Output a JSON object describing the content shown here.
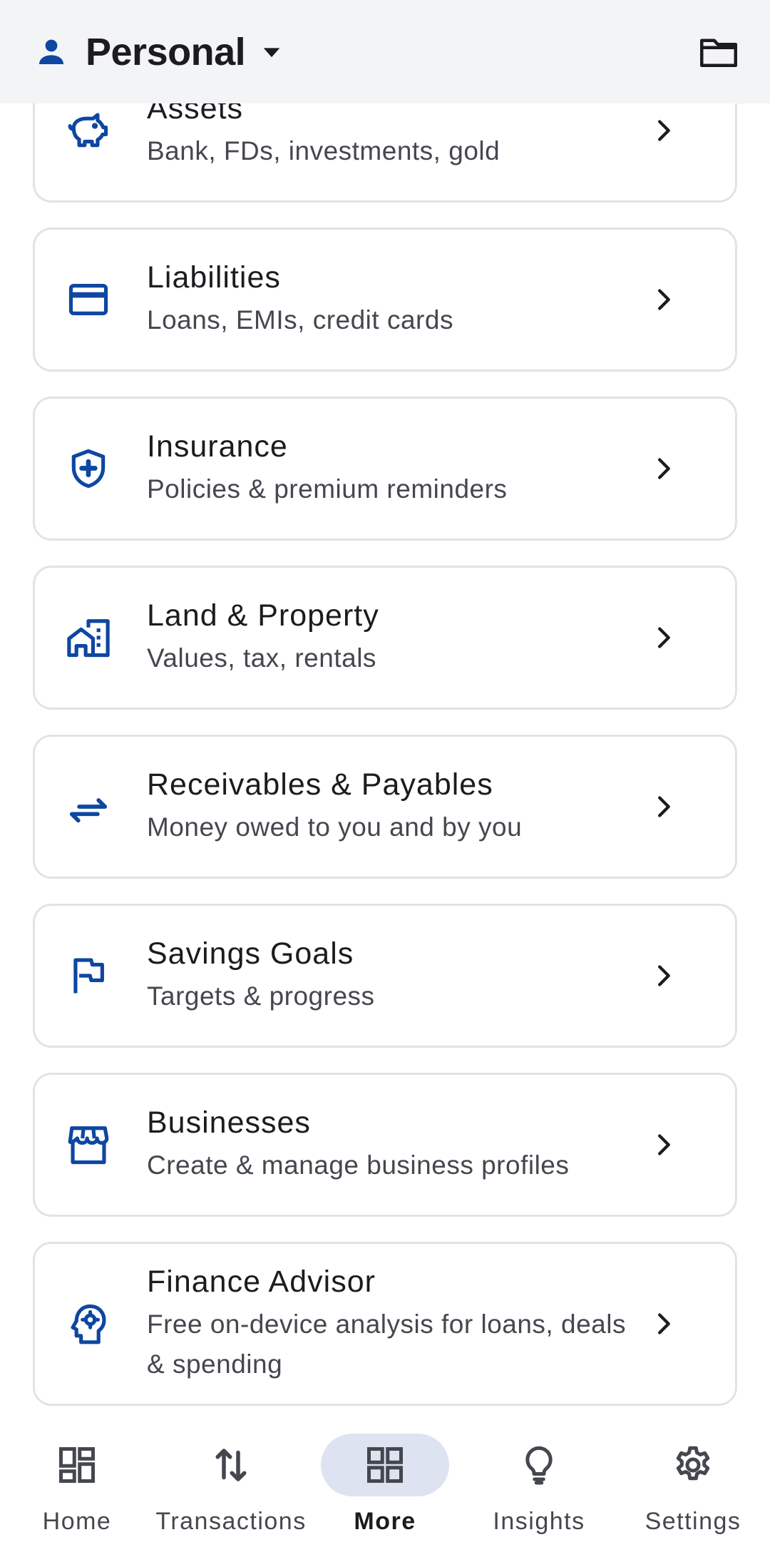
{
  "app_bar": {
    "title": "Personal",
    "icons": {
      "profile": "person-icon",
      "dropdown": "caret-down-icon",
      "folder": "folder-icon"
    }
  },
  "colors": {
    "accent": "#0d47a1",
    "card_border": "#e3e3e6",
    "nav_active_pill": "#dde3f0"
  },
  "cards": [
    {
      "title": "Assets",
      "subtitle": "Bank, FDs, investments, gold",
      "icon": "piggy-bank-icon"
    },
    {
      "title": "Liabilities",
      "subtitle": "Loans, EMIs, credit cards",
      "icon": "credit-card-icon"
    },
    {
      "title": "Insurance",
      "subtitle": "Policies & premium reminders",
      "icon": "shield-plus-icon"
    },
    {
      "title": "Land & Property",
      "subtitle": "Values, tax, rentals",
      "icon": "buildings-icon"
    },
    {
      "title": "Receivables & Payables",
      "subtitle": "Money owed to you and by you",
      "icon": "swap-arrows-icon"
    },
    {
      "title": "Savings Goals",
      "subtitle": "Targets & progress",
      "icon": "flag-icon"
    },
    {
      "title": "Businesses",
      "subtitle": "Create & manage business profiles",
      "icon": "storefront-icon"
    },
    {
      "title": "Finance Advisor",
      "subtitle": "Free on-device analysis for loans, deals & spending",
      "icon": "advisor-head-icon"
    }
  ],
  "nav": {
    "items": [
      {
        "label": "Home",
        "icon": "dashboard-icon"
      },
      {
        "label": "Transactions",
        "icon": "swap-vertical-icon"
      },
      {
        "label": "More",
        "icon": "grid-icon"
      },
      {
        "label": "Insights",
        "icon": "lightbulb-icon"
      },
      {
        "label": "Settings",
        "icon": "gear-icon"
      }
    ],
    "active": "More"
  }
}
